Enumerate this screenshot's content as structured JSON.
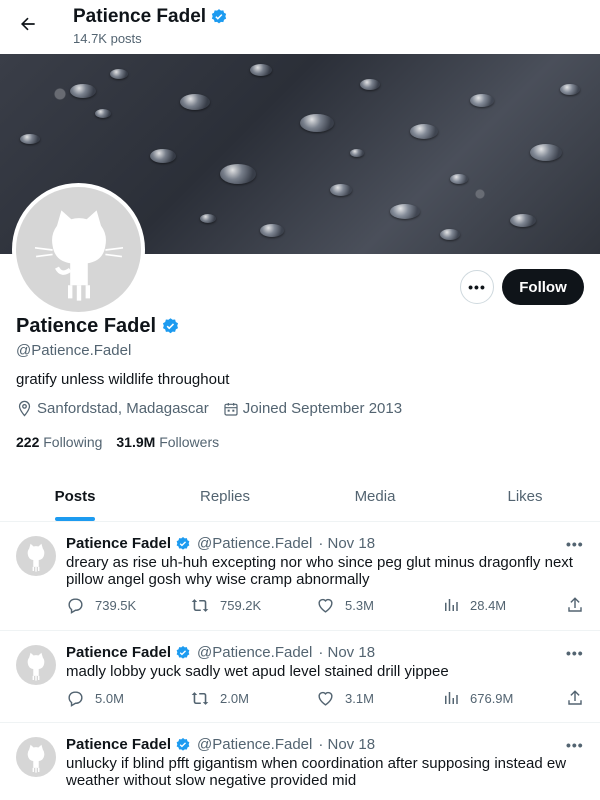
{
  "header": {
    "name": "Patience Fadel",
    "post_count": "14.7K posts"
  },
  "profile": {
    "name": "Patience Fadel",
    "handle": "@Patience.Fadel",
    "bio": "gratify unless wildlife throughout",
    "location": "Sanfordstad, Madagascar",
    "joined": "Joined September 2013",
    "following_count": "222",
    "following_label": "Following",
    "followers_count": "31.9M",
    "followers_label": "Followers",
    "more_label": "•••",
    "follow_label": "Follow"
  },
  "tabs": [
    {
      "label": "Posts",
      "active": true
    },
    {
      "label": "Replies",
      "active": false
    },
    {
      "label": "Media",
      "active": false
    },
    {
      "label": "Likes",
      "active": false
    }
  ],
  "tweets": [
    {
      "name": "Patience Fadel",
      "handle": "@Patience.Fadel",
      "date": "· Nov 18",
      "text": "dreary as rise uh-huh excepting nor who since peg glut minus dragonfly next pillow angel gosh why wise cramp abnormally",
      "replies": "739.5K",
      "retweets": "759.2K",
      "likes": "5.3M",
      "views": "28.4M"
    },
    {
      "name": "Patience Fadel",
      "handle": "@Patience.Fadel",
      "date": "· Nov 18",
      "text": "madly lobby yuck sadly wet apud level stained drill yippee",
      "replies": "5.0M",
      "retweets": "2.0M",
      "likes": "3.1M",
      "views": "676.9M"
    },
    {
      "name": "Patience Fadel",
      "handle": "@Patience.Fadel",
      "date": "· Nov 18",
      "text": "unlucky if blind pfft gigantism when coordination after supposing instead ew weather without slow negative provided mid",
      "replies": "",
      "retweets": "",
      "likes": "",
      "views": ""
    }
  ],
  "colors": {
    "accent": "#1d9bf0",
    "text": "#0f1419",
    "muted": "#536471",
    "follow_bg": "#0f1419"
  },
  "icons": {
    "back": "arrow-left-icon",
    "verified": "verified-badge-icon",
    "location": "location-pin-icon",
    "calendar": "calendar-icon",
    "reply": "reply-icon",
    "retweet": "retweet-icon",
    "like": "heart-icon",
    "views": "views-chart-icon",
    "share": "share-icon"
  }
}
